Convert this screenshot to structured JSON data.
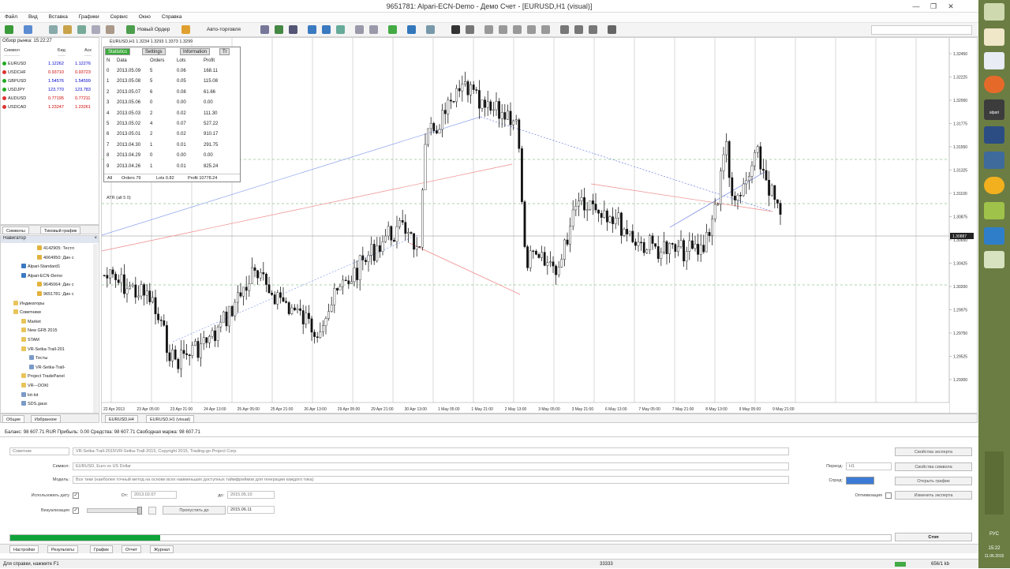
{
  "window": {
    "title": "9651781: Alpari-ECN-Demo - Демо Счет - [EURUSD,H1 (visual)]"
  },
  "menu": [
    "Файл",
    "Вид",
    "Вставка",
    "Графики",
    "Сервис",
    "Окно",
    "Справка"
  ],
  "toolbar": {
    "new_order": "Новый Ордер",
    "autotrading": "Авто-торговля"
  },
  "market_watch": {
    "title": "Обзор рынка: 15:22:27",
    "columns": [
      "Символ",
      "Бид",
      "Аск"
    ],
    "rows": [
      {
        "symbol": "EURUSD",
        "bid": "1.12262",
        "ask": "1.12276",
        "bid_color": "#0000cc",
        "ask_color": "#0000cc"
      },
      {
        "symbol": "USDCHF",
        "bid": "0.93710",
        "ask": "0.93723",
        "bid_color": "#d00000",
        "ask_color": "#d00000"
      },
      {
        "symbol": "GBPUSD",
        "bid": "1.54576",
        "ask": "1.54599",
        "bid_color": "#0000cc",
        "ask_color": "#0000cc"
      },
      {
        "symbol": "USDJPY",
        "bid": "123.770",
        "ask": "123.783",
        "bid_color": "#0000cc",
        "ask_color": "#0000cc"
      },
      {
        "symbol": "AUDUSD",
        "bid": "0.77195",
        "ask": "0.77211",
        "bid_color": "#d00000",
        "ask_color": "#d00000"
      },
      {
        "symbol": "USDCAD",
        "bid": "1.23247",
        "ask": "1.23261",
        "bid_color": "#d00000",
        "ask_color": "#d00000"
      }
    ],
    "tabs": [
      "Символы",
      "Тиковый график"
    ]
  },
  "navigator": {
    "title": "Навигатор",
    "items": [
      {
        "label": "4142905: Тестл",
        "level": 4,
        "icon": "account-icon"
      },
      {
        "label": "4064950: Дин с",
        "level": 4,
        "icon": "account-icon"
      },
      {
        "label": "Alpari-Standard1",
        "level": 2,
        "icon": "server-icon"
      },
      {
        "label": "Alpari-ECN-Demo",
        "level": 2,
        "icon": "server-icon"
      },
      {
        "label": "9645064: Дин с",
        "level": 4,
        "icon": "account-icon"
      },
      {
        "label": "9651781: Дин с",
        "level": 4,
        "icon": "account-icon"
      },
      {
        "label": "Индикаторы",
        "level": 1,
        "icon": "folder-icon"
      },
      {
        "label": "Советники",
        "level": 1,
        "icon": "folder-icon"
      },
      {
        "label": "Market",
        "level": 2,
        "icon": "folder-icon"
      },
      {
        "label": "New GFB 2015",
        "level": 2,
        "icon": "folder-icon"
      },
      {
        "label": "STAM",
        "level": 2,
        "icon": "folder-icon"
      },
      {
        "label": "VR-Setka-Trall-201",
        "level": 2,
        "icon": "folder-icon"
      },
      {
        "label": "Тесты",
        "level": 3,
        "icon": "ea-icon"
      },
      {
        "label": "VR-Setka-Trall-",
        "level": 3,
        "icon": "ea-icon"
      },
      {
        "label": "Project TradePanel",
        "level": 2,
        "icon": "folder-icon"
      },
      {
        "label": "VR---DOKI",
        "level": 2,
        "icon": "folder-icon"
      },
      {
        "label": "lot-lot",
        "level": 2,
        "icon": "ea-icon"
      },
      {
        "label": "SDS.gaus",
        "level": 2,
        "icon": "ea-icon"
      }
    ],
    "tabs": [
      "Общие",
      "Избранное"
    ]
  },
  "chart": {
    "header": "EURUSD,H1  1.3234 1.3293 1.3373 1.3299",
    "indicator_label": "ATR (alt 5 0)",
    "price_axis": [
      "1.32450",
      "1.32225",
      "1.32000",
      "1.31775",
      "1.31550",
      "1.31325",
      "1.31100",
      "1.30875",
      "1.30650",
      "1.30425",
      "1.30200",
      "1.29975",
      "1.29750",
      "1.29525",
      "1.29300"
    ],
    "current_price": "1.30887",
    "time_axis": [
      "22 Apr 2013",
      "23 Apr 05:00",
      "23 Apr 21:00",
      "24 Apr 13:00",
      "25 Apr 05:00",
      "25 Apr 21:00",
      "26 Apr 13:00",
      "29 Apr 05:00",
      "29 Apr 21:00",
      "30 Apr 13:00",
      "1 May 05:00",
      "1 May 21:00",
      "2 May 13:00",
      "3 May 05:00",
      "3 May 21:00",
      "6 May 13:00",
      "7 May 05:00",
      "7 May 21:00",
      "8 May 13:00",
      "9 May 05:00",
      "9 May 21:00"
    ],
    "tabs": [
      "EURUSD,H4",
      "EURUSD,H1 (visual)"
    ]
  },
  "statistics": {
    "tabs": [
      "Statistics",
      "Settings",
      "Information",
      "Tr"
    ],
    "columns": [
      "N",
      "Data",
      "Orders",
      "Lots",
      "Profit"
    ],
    "rows": [
      [
        "0",
        "2013.05.09",
        "5",
        "0.06",
        "168.11"
      ],
      [
        "1",
        "2013.05.08",
        "5",
        "0.05",
        "115.08"
      ],
      [
        "2",
        "2013.05.07",
        "6",
        "0.08",
        "61.66"
      ],
      [
        "3",
        "2013.05.06",
        "0",
        "0.00",
        "0.00"
      ],
      [
        "4",
        "2013.05.03",
        "2",
        "0.02",
        "111.30"
      ],
      [
        "5",
        "2013.05.02",
        "4",
        "0.07",
        "527.22"
      ],
      [
        "6",
        "2013.05.01",
        "2",
        "0.02",
        "910.17"
      ],
      [
        "7",
        "2013.04.30",
        "1",
        "0.01",
        "291.75"
      ],
      [
        "8",
        "2013.04.29",
        "0",
        "0.00",
        "0.00"
      ],
      [
        "9",
        "2013.04.26",
        "1",
        "0.01",
        "825.24"
      ]
    ],
    "footer": [
      "All",
      "Orders 79",
      "Lots 0.82",
      "Profit 10778.24"
    ]
  },
  "balance_line": "Баланс: 98 607.71 RUR  Прибыль: 0.00  Средства: 98 607.71  Свободная маржа: 98 607.71",
  "tester": {
    "mode": "Советник",
    "expert": "VR-Setka-Trall-2015\\VR-Setka-Trall-2015, Copyright 2015, Trading-go Project  Corp.",
    "symbol_label": "Символ:",
    "symbol": "EURUSD, Euro vs US Dollar",
    "model_label": "Модель:",
    "model": "Все тики (наиболее точный метод на основе всех наименьших доступных таймфреймов для генерации каждого тика)",
    "use_date_label": "Использовать дату",
    "from_label": "От:",
    "from_date": "2013.02.07",
    "to_label": "до:",
    "to_date": "2015.05.10",
    "visual_label": "Визуализация",
    "skip_button": "Пропустить до",
    "skip_date": "2015.06.11",
    "period_label": "Период:",
    "period": "H1",
    "spread_label": "Спред:",
    "optimization_label": "Оптимизация",
    "buttons": [
      "Свойства эксперта",
      "Свойства символа",
      "Открыть график",
      "Изменить эксперта"
    ],
    "stop_button": "Стоп",
    "progress": 0.17,
    "tabs": [
      "Настройки",
      "Результаты",
      "График",
      "Отчет",
      "Журнал"
    ]
  },
  "status": {
    "help": "Для справки, нажмите F1",
    "profile": "33333",
    "traffic": "656/1 kb"
  },
  "taskbar": {
    "lang": "РУС",
    "time": "15:22",
    "date": "11.06.2015",
    "alpari": "alpari"
  },
  "colors": {
    "bull": "#000000",
    "bear": "#000000",
    "accent": "#10a33a",
    "taskbar": "#6b7d43"
  }
}
